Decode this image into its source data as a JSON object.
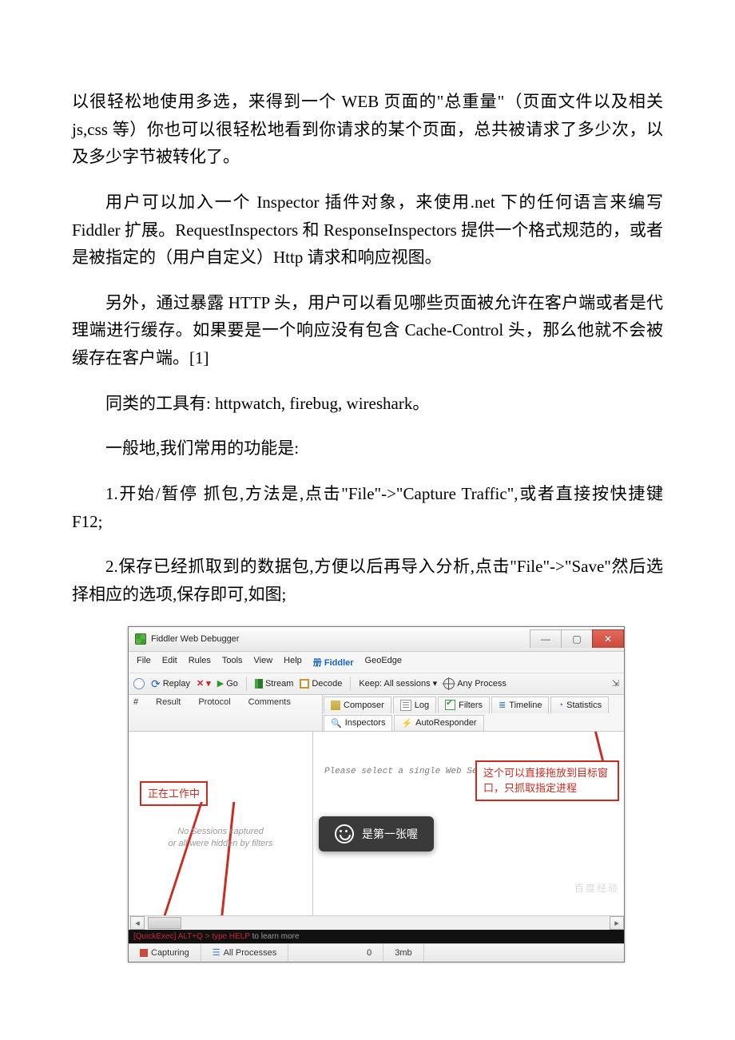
{
  "doc": {
    "p1": "以很轻松地使用多选，来得到一个 WEB 页面的\"总重量\"（页面文件以及相关 js,css 等）你也可以很轻松地看到你请求的某个页面，总共被请求了多少次，以及多少字节被转化了。",
    "p2": "用户可以加入一个 Inspector 插件对象，来使用.net 下的任何语言来编写 Fiddler 扩展。RequestInspectors 和 ResponseInspectors 提供一个格式规范的，或者是被指定的（用户自定义）Http 请求和响应视图。",
    "p3": "另外，通过暴露 HTTP 头，用户可以看见哪些页面被允许在客户端或者是代理端进行缓存。如果要是一个响应没有包含 Cache-Control 头，那么他就不会被缓存在客户端。[1]",
    "p4": "同类的工具有: httpwatch, firebug, wireshark。",
    "p5": "一般地,我们常用的功能是:",
    "p6": "1.开始/暂停 抓包,方法是,点击\"File\"->\"Capture Traffic\",或者直接按快捷键 F12;",
    "p7": "2.保存已经抓取到的数据包,方便以后再导入分析,点击\"File\"->\"Save\"然后选择相应的选项,保存即可,如图;"
  },
  "app": {
    "title": "Fiddler Web Debugger",
    "menu": {
      "file": "File",
      "edit": "Edit",
      "rules": "Rules",
      "tools": "Tools",
      "view": "View",
      "help": "Help",
      "brand": "册 Fiddler",
      "geo": "GeoEdge"
    },
    "toolbar": {
      "replay": "Replay",
      "x": "✕ ▾",
      "go": "Go",
      "stream": "Stream",
      "decode": "Decode",
      "keep": "Keep: All sessions ▾",
      "anyproc": "Any Process"
    },
    "columns": {
      "num": "#",
      "result": "Result",
      "protocol": "Protocol",
      "comments": "Comments"
    },
    "tabs": {
      "composer": "Composer",
      "log": "Log",
      "filters": "Filters",
      "timeline": "Timeline",
      "statistics": "Statistics",
      "inspectors": "Inspectors",
      "autoresponder": "AutoResponder"
    },
    "left_msg1": "No Sessions captured",
    "left_msg2": "or all were hidden by filters",
    "right_msg": "Please select a single Web Session to inspect",
    "callout_left": "正在工作中",
    "callout_right": "这个可以直接拖放到目标窗口，只抓取指定进程",
    "toast": "是第一张喔",
    "quickexec_prefix": "[QuickExec] ALT+Q > type ",
    "quickexec_help": "HELP",
    "quickexec_suffix": " to learn more",
    "status": {
      "capturing": "Capturing",
      "allproc": "All Processes",
      "count": "0",
      "size": "3mb"
    },
    "watermark": "百度经验"
  }
}
